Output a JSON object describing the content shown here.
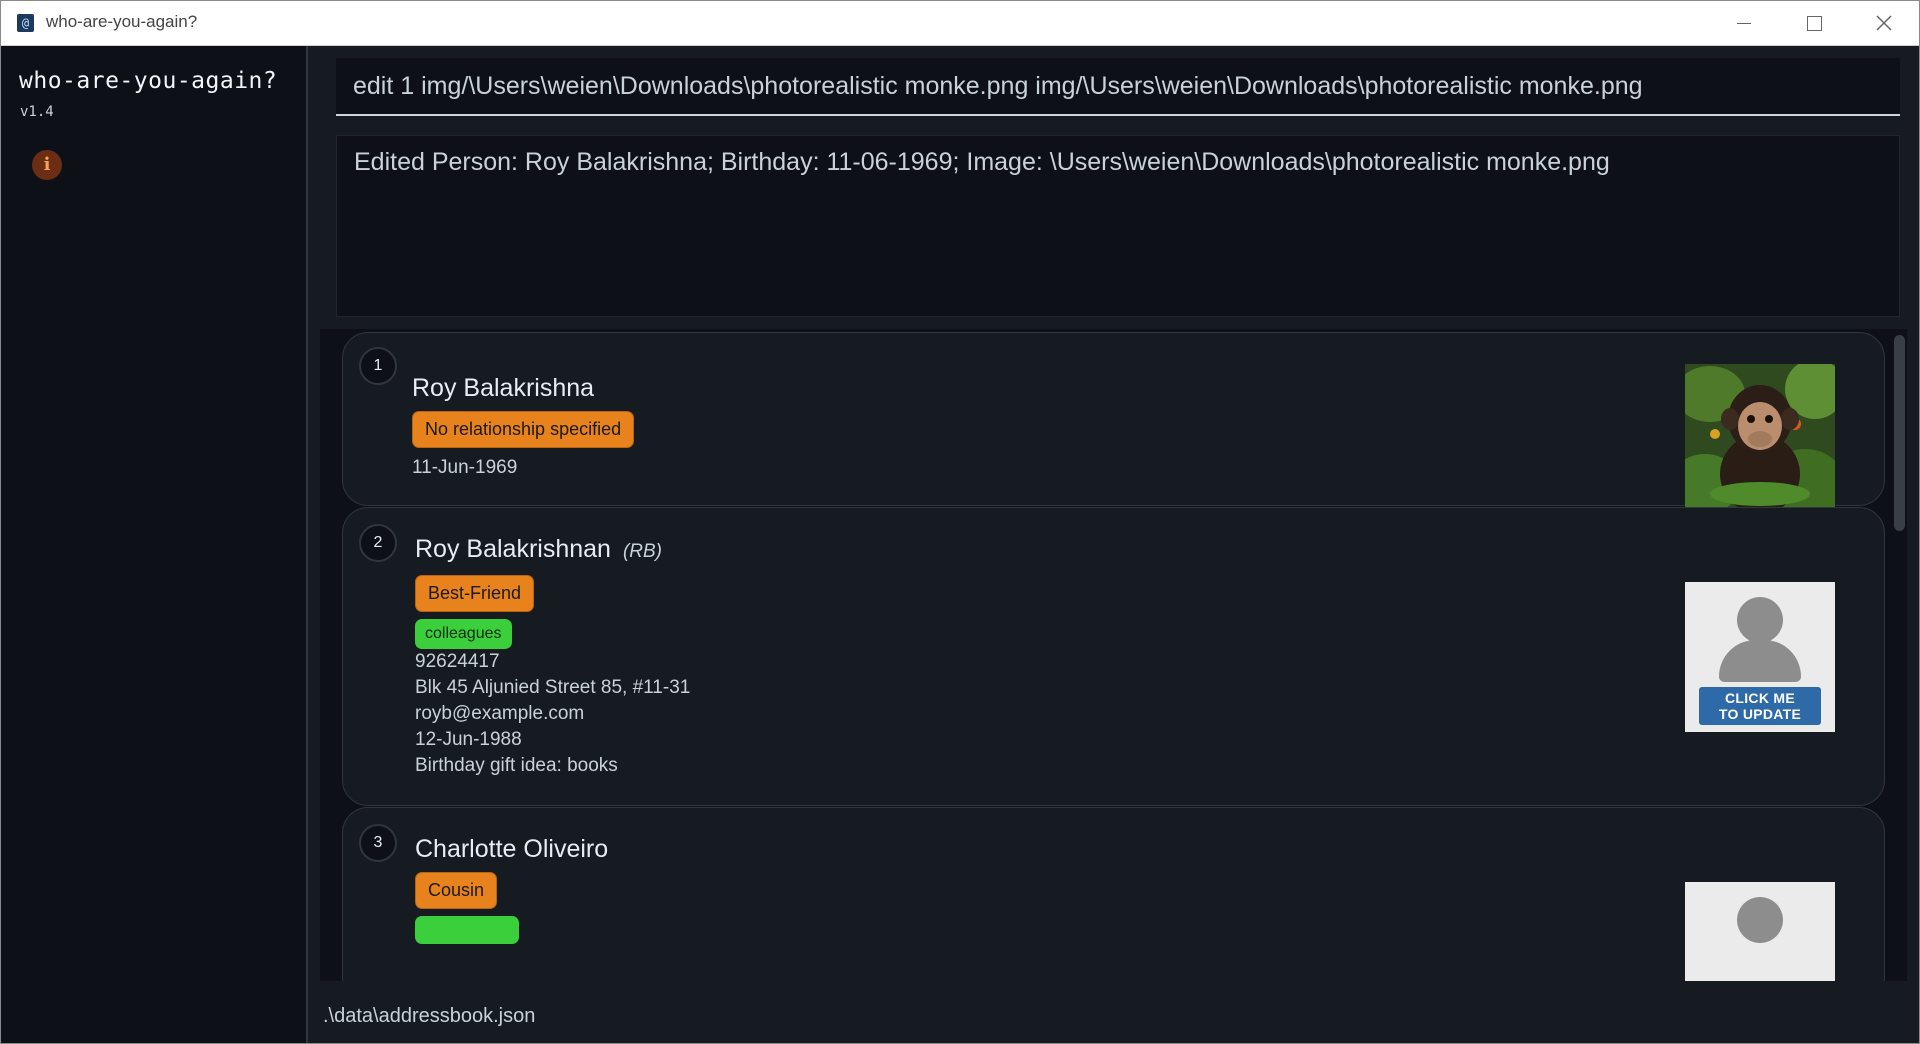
{
  "window": {
    "title": "who-are-you-again?",
    "icon": "app-icon",
    "icon_glyph": "@"
  },
  "sidebar": {
    "app_name": "who-are-you-again?",
    "version": "v1.4",
    "info_icon_glyph": "i"
  },
  "command": {
    "value": "edit 1 img/\\Users\\weien\\Downloads\\photorealistic monke.png img/\\Users\\weien\\Downloads\\photorealistic monke.png"
  },
  "result": {
    "text": "Edited Person: Roy Balakrishna; Birthday: 11-06-1969; Image: \\Users\\weien\\Downloads\\photorealistic monke.png"
  },
  "persons": [
    {
      "index": "1",
      "name": "Roy Balakrishna",
      "relationship": "No relationship specified",
      "birthday": "11-Jun-1969",
      "photo": "chimpanzee-photo"
    },
    {
      "index": "2",
      "name": "Roy Balakrishnan",
      "nickname": "(RB)",
      "relationship": "Best-Friend",
      "tag": "colleagues",
      "phone": "92624417",
      "address": "Blk 45 Aljunied Street 85, #11-31",
      "email": "royb@example.com",
      "birthday": "12-Jun-1988",
      "notes": "Birthday gift idea: books",
      "photo_button": "CLICK ME TO UPDATE"
    },
    {
      "index": "3",
      "name": "Charlotte Oliveiro",
      "relationship": "Cousin"
    }
  ],
  "status": {
    "path": ".\\data\\addressbook.json"
  },
  "colors": {
    "background": "#0d1117",
    "panel": "#161b22",
    "relationship_tag": "#e8821c",
    "green_tag": "#3ccf3c",
    "photo_button": "#2e69a8"
  }
}
